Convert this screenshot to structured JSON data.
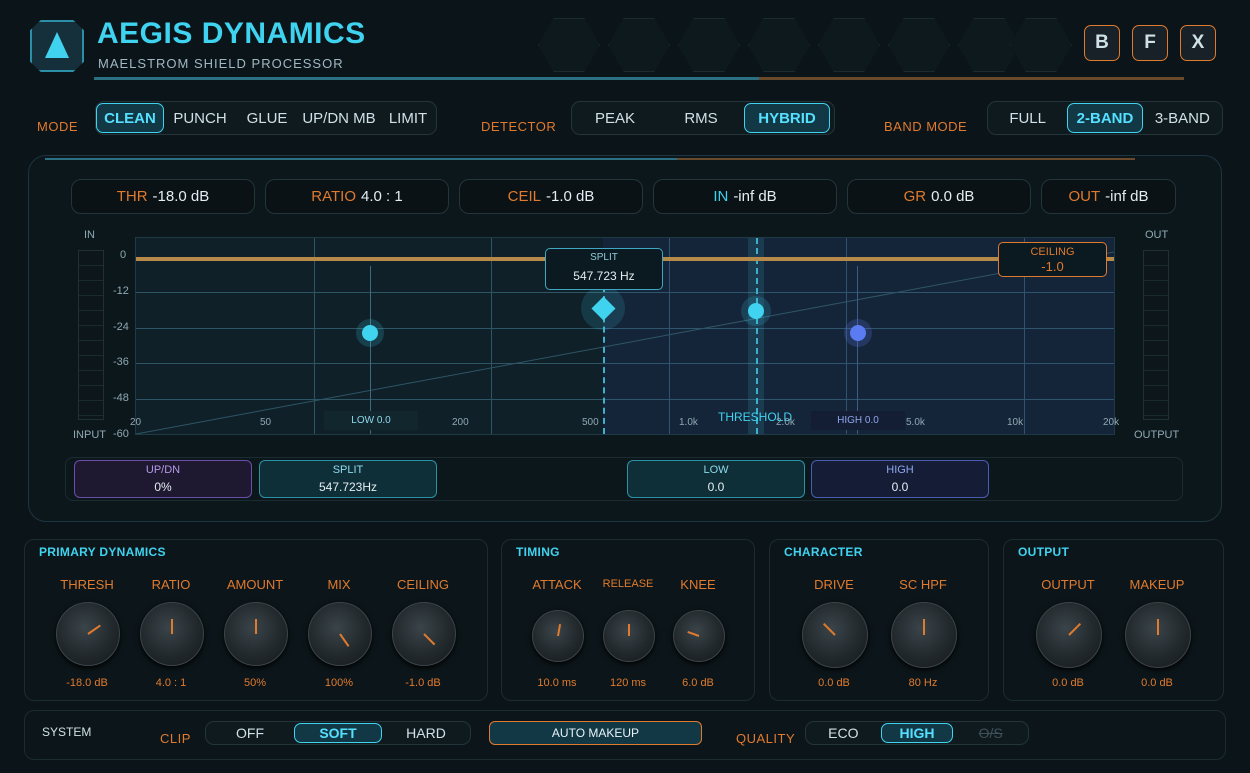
{
  "header": {
    "title": "AEGIS DYNAMICS",
    "subtitle": "MAELSTROM SHIELD PROCESSOR",
    "buttons": [
      "B",
      "F",
      "X"
    ],
    "logo_icon": "triangle-logo-icon"
  },
  "mode": {
    "label": "MODE",
    "options": [
      "CLEAN",
      "PUNCH",
      "GLUE",
      "UP/DN MB",
      "LIMIT"
    ],
    "selected": "CLEAN"
  },
  "detector": {
    "label": "DETECTOR",
    "options": [
      "PEAK",
      "RMS",
      "HYBRID"
    ],
    "selected": "HYBRID"
  },
  "band_mode": {
    "label": "BAND MODE",
    "options": [
      "FULL",
      "2-BAND",
      "3-BAND"
    ],
    "selected": "2-BAND"
  },
  "meters": [
    {
      "key": "THR",
      "value": "-18.0 dB"
    },
    {
      "key": "RATIO",
      "value": "4.0 : 1"
    },
    {
      "key": "CEIL",
      "value": "-1.0 dB"
    },
    {
      "key": "IN",
      "value": "-inf dB"
    },
    {
      "key": "GR",
      "value": "0.0 dB"
    },
    {
      "key": "OUT",
      "value": "-inf dB"
    }
  ],
  "graph": {
    "in_label": "IN",
    "out_label": "OUT",
    "input_label": "INPUT",
    "output_label": "OUTPUT",
    "y_ticks": [
      "0",
      "-12",
      "-24",
      "-36",
      "-48",
      "-60"
    ],
    "x_ticks": [
      "20",
      "50",
      "200",
      "500",
      "1.0k",
      "2.0k",
      "5.0k",
      "10k",
      "20k"
    ],
    "split_tag": {
      "title": "SPLIT",
      "value": "547.723 Hz"
    },
    "ceiling_tag": {
      "title": "CEILING",
      "value": "-1.0"
    },
    "threshold_label": "THRESHOLD",
    "low_tag": "LOW 0.0",
    "high_tag": "HIGH 0.0"
  },
  "pills": {
    "updn": {
      "title": "UP/DN",
      "value": "0%"
    },
    "split": {
      "title": "SPLIT",
      "value": "547.723Hz"
    },
    "low": {
      "title": "LOW",
      "value": "0.0"
    },
    "high": {
      "title": "HIGH",
      "value": "0.0"
    }
  },
  "sections": {
    "primary": {
      "title": "PRIMARY DYNAMICS",
      "knobs": [
        {
          "label": "THRESH",
          "value": "-18.0 dB"
        },
        {
          "label": "RATIO",
          "value": "4.0 : 1"
        },
        {
          "label": "AMOUNT",
          "value": "50%"
        },
        {
          "label": "MIX",
          "value": "100%"
        },
        {
          "label": "CEILING",
          "value": "-1.0 dB"
        }
      ]
    },
    "timing": {
      "title": "TIMING",
      "knobs": [
        {
          "label": "ATTACK",
          "value": "10.0 ms"
        },
        {
          "label": "RELEASE",
          "value": "120 ms"
        },
        {
          "label": "KNEE",
          "value": "6.0 dB"
        }
      ]
    },
    "character": {
      "title": "CHARACTER",
      "knobs": [
        {
          "label": "DRIVE",
          "value": "0.0 dB"
        },
        {
          "label": "SC HPF",
          "value": "80 Hz"
        }
      ]
    },
    "output": {
      "title": "OUTPUT",
      "knobs": [
        {
          "label": "OUTPUT",
          "value": "0.0 dB"
        },
        {
          "label": "MAKEUP",
          "value": "0.0 dB"
        }
      ]
    }
  },
  "system": {
    "label": "SYSTEM",
    "clip_label": "CLIP",
    "clip_options": [
      "OFF",
      "SOFT",
      "HARD"
    ],
    "clip_selected": "SOFT",
    "auto_makeup": "AUTO MAKEUP",
    "quality_label": "QUALITY",
    "quality_options": [
      "ECO",
      "HIGH",
      "O/S"
    ],
    "quality_selected": "HIGH"
  },
  "colors": {
    "accent": "#3fd3f0",
    "orange": "#e07a2e",
    "purple": "#9a7ad8",
    "blue": "#5a7cf0",
    "background": "#0b1418"
  }
}
